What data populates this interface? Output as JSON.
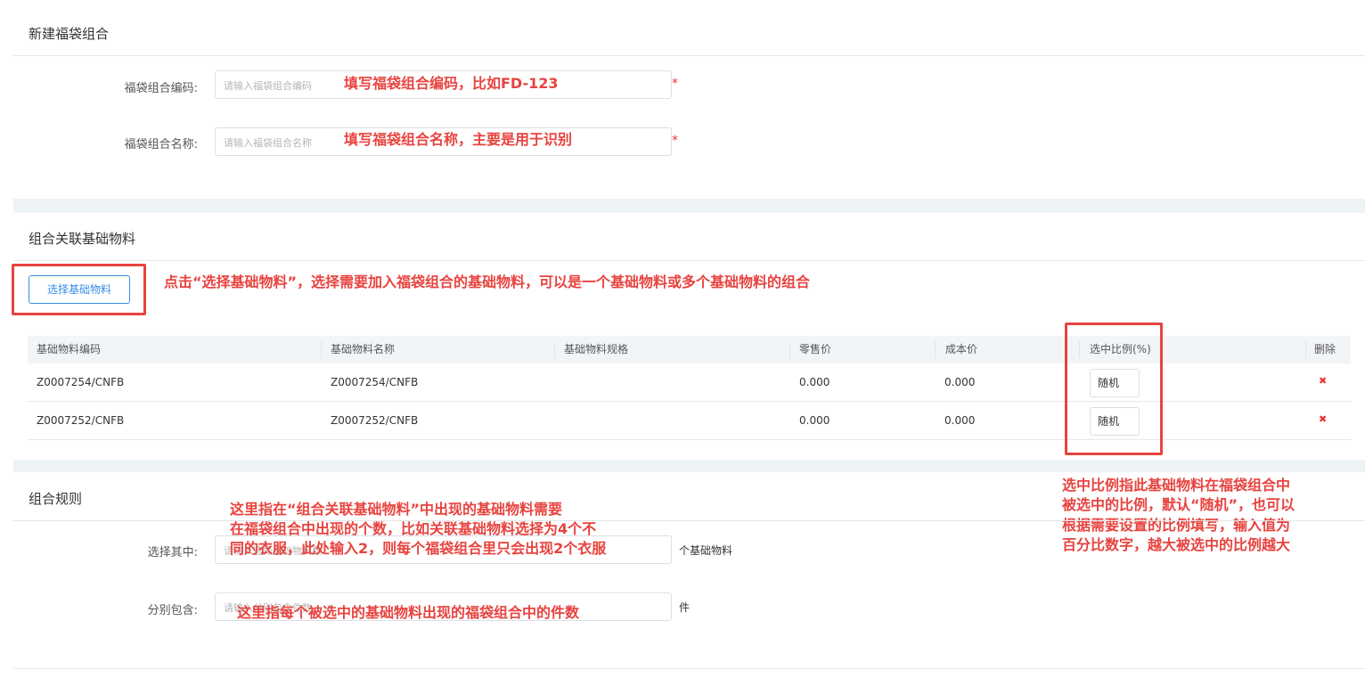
{
  "section1": {
    "title": "新建福袋组合",
    "code_label": "福袋组合编码:",
    "code_placeholder": "请输入福袋组合编码",
    "code_annotation": "填写福袋组合编码，比如FD-123",
    "name_label": "福袋组合名称:",
    "name_placeholder": "请输入福袋组合名称",
    "name_annotation": "填写福袋组合名称，主要是用于识别",
    "required_mark": "*"
  },
  "section2": {
    "title": "组合关联基础物料",
    "select_button": "选择基础物料",
    "select_annotation": "点击“选择基础物料”，选择需要加入福袋组合的基础物料，可以是一个基础物料或多个基础物料的组合",
    "table": {
      "headers": [
        "基础物料编码",
        "基础物料名称",
        "基础物料规格",
        "零售价",
        "成本价",
        "选中比例(%)",
        "删除"
      ],
      "rows": [
        {
          "code": "Z0007254/CNFB",
          "name": "Z0007254/CNFB",
          "spec": "",
          "retail": "0.000",
          "cost": "0.000",
          "ratio": "随机"
        },
        {
          "code": "Z0007252/CNFB",
          "name": "Z0007252/CNFB",
          "spec": "",
          "retail": "0.000",
          "cost": "0.000",
          "ratio": "随机"
        }
      ],
      "delete_icon": "close-icon",
      "delete_glyph": "✖"
    },
    "ratio_annotation": [
      "选中比例指此基础物料在福袋组合中",
      "被选中的比例，默认“随机”，也可以",
      "根据需要设置的比例填写，输入值为",
      "百分比数字，越大被选中的比例越大"
    ]
  },
  "section3": {
    "title": "组合规则",
    "choose_label": "选择其中:",
    "choose_placeholder": "请输入选择基础物料数",
    "choose_suffix": "个基础物料",
    "choose_annotation": [
      "这里指在“组合关联基础物料”中出现的基础物料需要",
      "在福袋组合中出现的个数，比如关联基础物料选择为4个不",
      "同的衣服，此处输入2，则每个福袋组合里只会出现2个衣服"
    ],
    "include_label": "分别包含:",
    "include_placeholder": "请输入分别包含件数",
    "include_suffix": "件",
    "include_annotation": "这里指每个被选中的基础物料出现的福袋组合中的件数"
  },
  "colors": {
    "annotation": "#e8433f",
    "primary": "#3a8ee6",
    "band": "#eef3f6"
  }
}
